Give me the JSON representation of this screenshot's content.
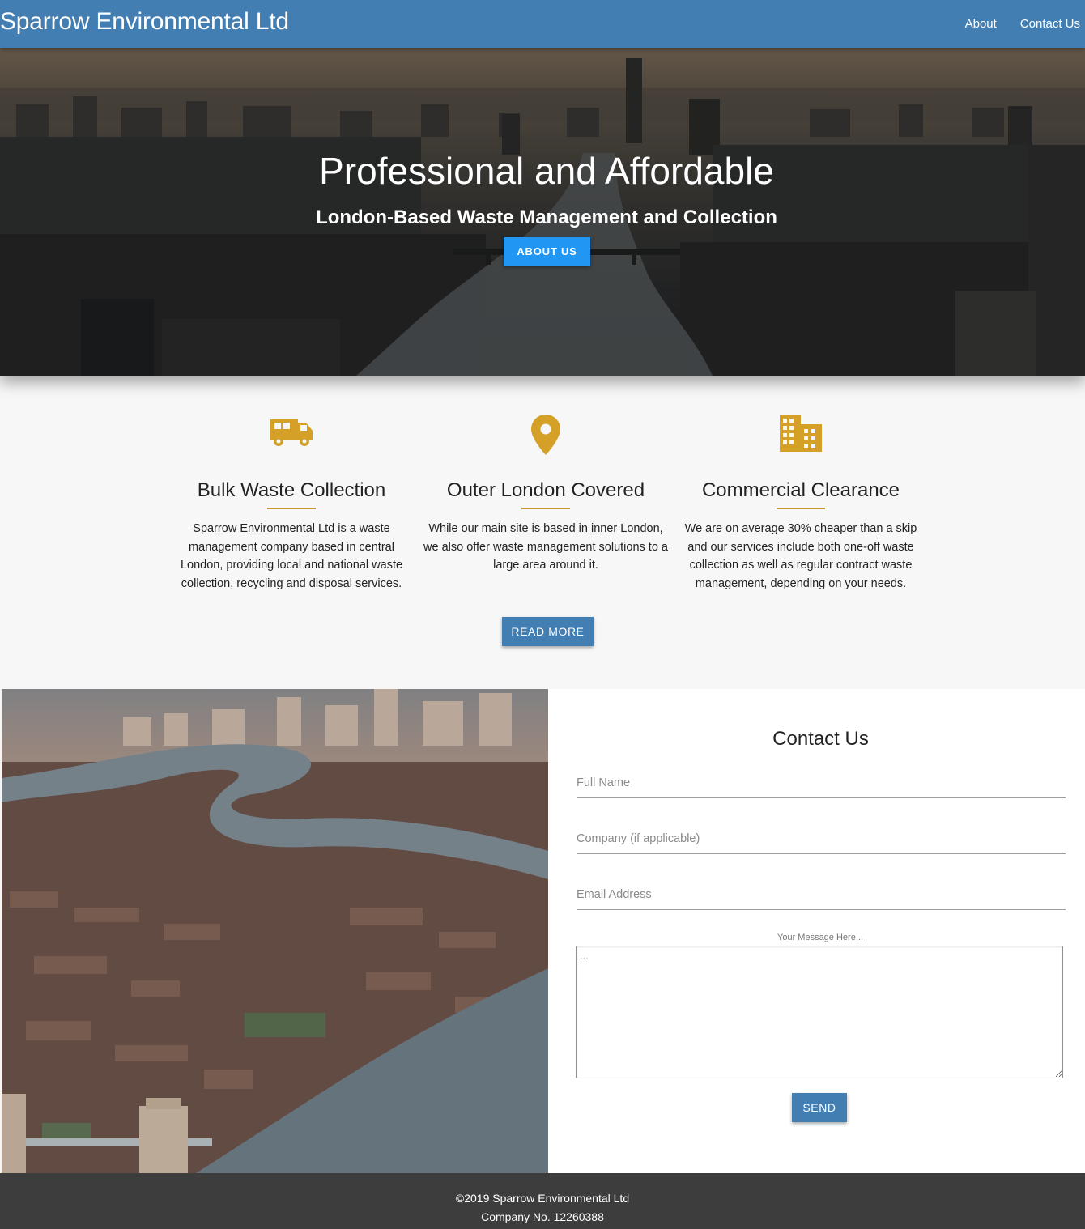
{
  "nav": {
    "brand": "Sparrow Environmental Ltd",
    "links": [
      "About",
      "Contact Us"
    ]
  },
  "hero": {
    "title": "Professional and Affordable",
    "subtitle": "London-Based Waste Management and Collection",
    "button": "ABOUT US"
  },
  "features": {
    "items": [
      {
        "icon": "van-icon",
        "title": "Bulk Waste Collection",
        "text": "Sparrow Environmental Ltd is a waste management company based in central London, providing local and national waste collection, recycling and disposal services."
      },
      {
        "icon": "map-pin-icon",
        "title": "Outer London Covered",
        "text": "While our main site is based in inner London, we also offer waste management solutions to a large area around it."
      },
      {
        "icon": "building-icon",
        "title": "Commercial Clearance",
        "text": "We are on average 30% cheaper than a skip and our services include both one-off waste collection as well as regular contract waste management, depending on your needs."
      }
    ],
    "button": "READ MORE"
  },
  "contact": {
    "title": "Contact Us",
    "fields": {
      "name_placeholder": "Full Name",
      "company_placeholder": "Company (if applicable)",
      "email_placeholder": "Email Address"
    },
    "message_label": "Your Message Here...",
    "message_placeholder": "...",
    "send": "SEND"
  },
  "footer": {
    "copyright": "©2019 Sparrow Environmental Ltd",
    "company_no": "Company No. 12260388"
  },
  "colors": {
    "nav": "#437eb2",
    "accent_button": "#2196f3",
    "icon_gold": "#d4a028",
    "footer": "#3d3d3d"
  }
}
